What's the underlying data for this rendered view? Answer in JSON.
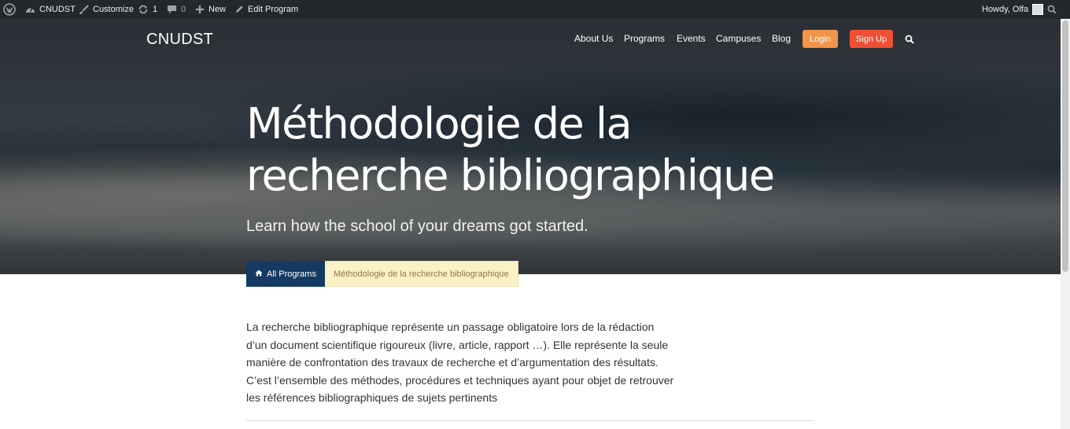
{
  "admin_bar": {
    "site_name": "CNUDST",
    "customize": "Customize",
    "updates_count": "1",
    "comments_count": "0",
    "new_label": "New",
    "edit_label": "Edit Program",
    "greeting": "Howdy, Olfa"
  },
  "header": {
    "brand": "CNUDST",
    "nav": [
      "About Us",
      "Programs",
      "Events",
      "Campuses",
      "Blog"
    ],
    "login_label": "Login",
    "signup_label": "Sign Up"
  },
  "hero": {
    "title": "Méthodologie de la recherche bibliographique",
    "subtitle": "Learn how the school of your dreams got started."
  },
  "breadcrumb": {
    "all_label": "All Programs",
    "current": "Méthodologie de la recherche bibliographique"
  },
  "content": {
    "paragraph": "La recherche bibliographique représente un passage obligatoire lors de la rédaction d’un document scientifique rigoureux (livre, article, rapport …). Elle représente la seule manière de confrontation des travaux de recherche et d’argumentation des résultats. C’est l’ensemble des méthodes, procédures et techniques ayant pour objet de retrouver les références bibliographiques de sujets pertinents"
  },
  "colors": {
    "admin_bar": "#23282d",
    "login": "#f0954a",
    "signup": "#ef5035",
    "breadcrumb_active": "#153a62",
    "breadcrumb_current": "#fbf0c6"
  },
  "icons": [
    "wordpress-icon",
    "dashboard-icon",
    "brush-icon",
    "updates-icon",
    "comment-icon",
    "plus-icon",
    "pencil-icon",
    "search-icon",
    "home-icon"
  ]
}
